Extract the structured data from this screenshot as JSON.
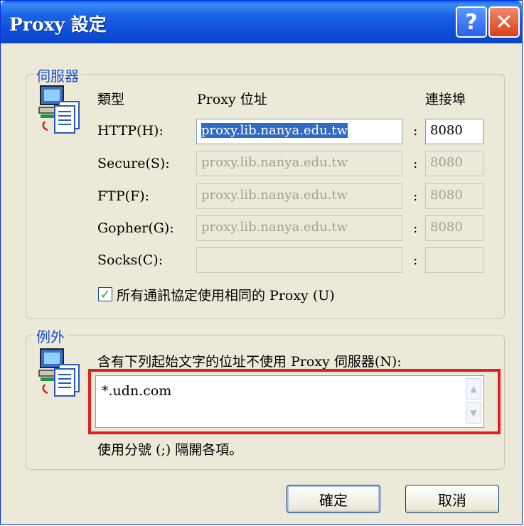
{
  "window": {
    "title": "Proxy 設定"
  },
  "titlebar": {
    "help_glyph": "?",
    "close_glyph": "✕"
  },
  "servers": {
    "legend": "伺服器",
    "header_type": "類型",
    "header_address": "Proxy 位址",
    "header_port": "連接埠",
    "rows": [
      {
        "label": "HTTP(H):",
        "address": "proxy.lib.nanya.edu.tw",
        "port": "8080",
        "enabled": true
      },
      {
        "label": "Secure(S):",
        "address": "proxy.lib.nanya.edu.tw",
        "port": "8080",
        "enabled": false
      },
      {
        "label": "FTP(F):",
        "address": "proxy.lib.nanya.edu.tw",
        "port": "8080",
        "enabled": false
      },
      {
        "label": "Gopher(G):",
        "address": "proxy.lib.nanya.edu.tw",
        "port": "8080",
        "enabled": false
      },
      {
        "label": "Socks(C):",
        "address": "",
        "port": "",
        "enabled": false
      }
    ],
    "colon": ":",
    "same_proxy_label": "所有通訊協定使用相同的 Proxy (U)",
    "same_proxy_checked": true
  },
  "exceptions": {
    "legend": "例外",
    "description": "含有下列起始文字的位址不使用 Proxy 伺服器(N):",
    "value": "*.udn.com",
    "hint": "使用分號 (;) 隔開各項。"
  },
  "buttons": {
    "ok": "確定",
    "cancel": "取消"
  },
  "colors": {
    "titlebar": "#0f4fd8",
    "accent": "#1e50d0",
    "highlight": "#e02020",
    "face": "#ece9d8"
  }
}
